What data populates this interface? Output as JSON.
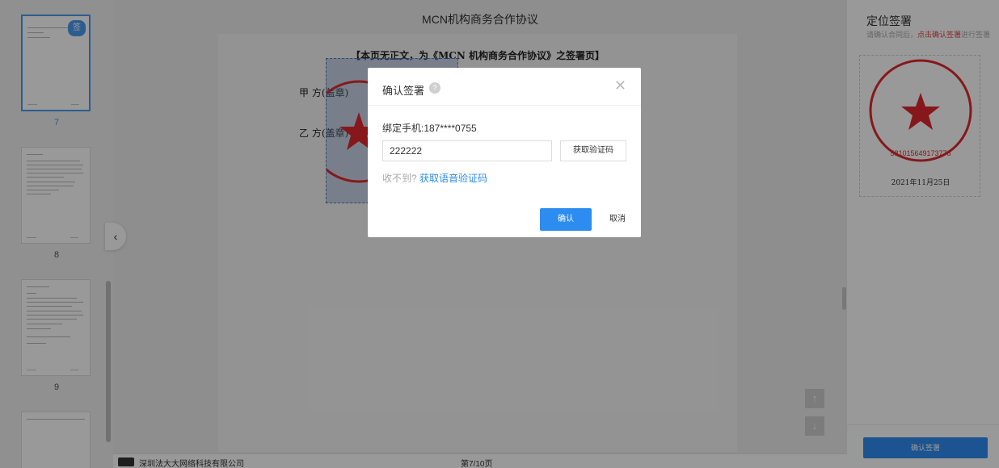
{
  "document": {
    "title": "MCN机构商务合作协议",
    "page_heading": "【本页无正文，为《MCN 机构商务合作协议》之签署页】",
    "party_a": "甲   方(盖章)",
    "party_b": "乙   方(盖章)"
  },
  "thumbnails": [
    {
      "page": "7",
      "active": true,
      "badge": "签"
    },
    {
      "page": "8",
      "active": false
    },
    {
      "page": "9",
      "active": false
    },
    {
      "page": "",
      "active": false
    }
  ],
  "footer": {
    "company": "深圳法大大网络科技有限公司",
    "page_indicator": "第7/10页"
  },
  "right_panel": {
    "title": "定位签署",
    "hint_prefix": "请确认合同后，",
    "hint_action": "点击确认签署",
    "hint_suffix": "进行签署",
    "seal_text": "尼康泰仪器销售（中国）有限公司",
    "seal_number": "581015649173778",
    "seal_date": "2021年11月25日",
    "confirm_button": "确认签署"
  },
  "dialog": {
    "title": "确认签署",
    "bound_phone": "绑定手机:187****0755",
    "code_value": "222222",
    "get_code_button": "获取验证码",
    "not_received": "收不到?",
    "voice_code_link": "获取语音验证码",
    "ok_button": "确认",
    "cancel_button": "取消"
  },
  "colors": {
    "accent": "#2d8cf0",
    "seal_red": "#e0282e",
    "hint_red": "#e04545"
  }
}
